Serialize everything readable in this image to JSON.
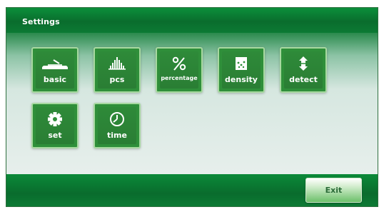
{
  "header": {
    "title": "Settings"
  },
  "tiles_row1": [
    {
      "name": "basic",
      "label": "basic",
      "icon": "scale-icon"
    },
    {
      "name": "pcs",
      "label": "pcs",
      "icon": "piece-count-icon"
    },
    {
      "name": "percentage",
      "label": "percentage",
      "icon": "percent-icon"
    },
    {
      "name": "density",
      "label": "density",
      "icon": "density-icon"
    },
    {
      "name": "detect",
      "label": "detect",
      "icon": "detect-arrow-icon"
    }
  ],
  "tiles_row2": [
    {
      "name": "set",
      "label": "set",
      "icon": "gear-icon"
    },
    {
      "name": "time",
      "label": "time",
      "icon": "clock-icon"
    }
  ],
  "footer": {
    "exit_label": "Exit"
  },
  "colors": {
    "accent_green": "#2f8f3a",
    "header_green": "#0a6d2d",
    "tile_border": "#a7d9a0"
  }
}
